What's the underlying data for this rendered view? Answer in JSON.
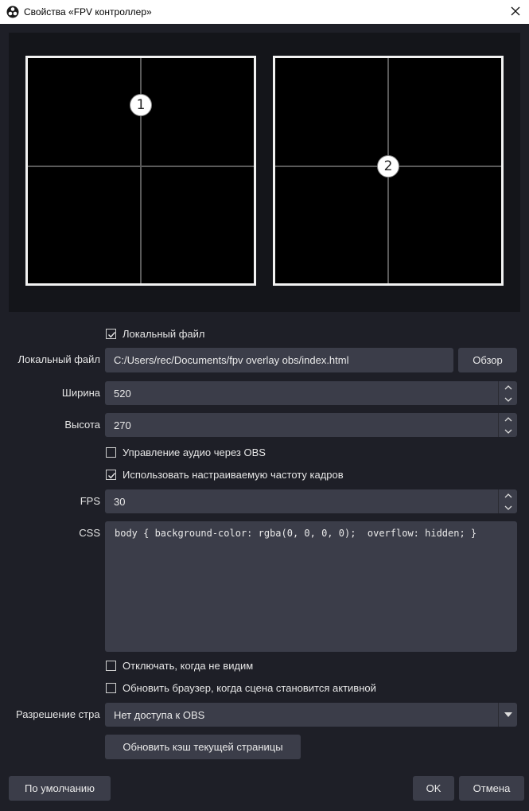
{
  "window": {
    "title": "Свойства «FPV контроллер»",
    "icon": "obs-icon",
    "close_icon": "close-icon"
  },
  "preview": {
    "screens": [
      {
        "marker": "1"
      },
      {
        "marker": "2"
      }
    ]
  },
  "form": {
    "local_file_checkbox": {
      "label": "Локальный файл",
      "checked": true
    },
    "local_file": {
      "label": "Локальный файл",
      "value": "C:/Users/rec/Documents/fpv overlay obs/index.html",
      "browse_label": "Обзор"
    },
    "width": {
      "label": "Ширина",
      "value": "520"
    },
    "height": {
      "label": "Высота",
      "value": "270"
    },
    "audio_checkbox": {
      "label": "Управление аудио через OBS",
      "checked": false
    },
    "custom_fps_checkbox": {
      "label": "Использовать настраиваемую частоту кадров",
      "checked": true
    },
    "fps": {
      "label": "FPS",
      "value": "30"
    },
    "css": {
      "label": "CSS",
      "value": "body { background-color: rgba(0, 0, 0, 0);  overflow: hidden; }"
    },
    "shutdown_checkbox": {
      "label": "Отключать, когда не видим",
      "checked": false
    },
    "refresh_checkbox": {
      "label": "Обновить браузер, когда сцена становится активной",
      "checked": false
    },
    "permissions": {
      "label": "Разрешение стра",
      "value": "Нет доступа к OBS"
    },
    "refresh_cache_label": "Обновить кэш текущей страницы"
  },
  "footer": {
    "defaults_label": "По умолчанию",
    "ok_label": "OK",
    "cancel_label": "Отмена"
  },
  "colors": {
    "background": "#1e1f27",
    "field": "#3b3d49",
    "preview_bg": "#14151a"
  }
}
